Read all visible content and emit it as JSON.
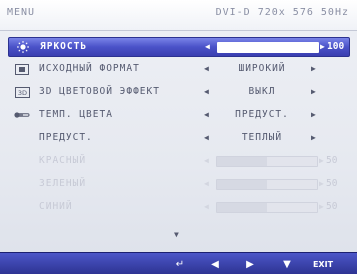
{
  "header": {
    "title": "MENU",
    "input": "DVI-D",
    "resolution": "720x 576",
    "refresh": "50Hz"
  },
  "menu": {
    "items": [
      {
        "icon": "sun-brightness-icon",
        "label": "ЯРКОСТЬ",
        "type": "slider",
        "value": 100,
        "max": 100,
        "selected": true,
        "enabled": true
      },
      {
        "icon": "aspect-ratio-icon",
        "label": "ИСХОДНЫЙ ФОРМАТ",
        "type": "option",
        "value": "ШИРОКИЙ",
        "selected": false,
        "enabled": true
      },
      {
        "icon": "3d-icon",
        "label": "3D ЦВЕТОВОЙ ЭФФЕКТ",
        "type": "option",
        "value": "ВЫКЛ",
        "selected": false,
        "enabled": true
      },
      {
        "icon": "thermometer-icon",
        "label": "ТЕМП. ЦВЕТА",
        "type": "option",
        "value": "ПРЕДУСТ.",
        "selected": false,
        "enabled": true
      },
      {
        "icon": "",
        "label": "ПРЕДУСТ.",
        "type": "option",
        "value": "ТЕПЛЫЙ",
        "selected": false,
        "enabled": true
      },
      {
        "icon": "",
        "label": "КРАСНЫЙ",
        "type": "slider",
        "value": 50,
        "max": 100,
        "selected": false,
        "enabled": false
      },
      {
        "icon": "",
        "label": "ЗЕЛЕНЫЙ",
        "type": "slider",
        "value": 50,
        "max": 100,
        "selected": false,
        "enabled": false
      },
      {
        "icon": "",
        "label": "СИНИЙ",
        "type": "slider",
        "value": 50,
        "max": 100,
        "selected": false,
        "enabled": false
      }
    ],
    "more_indicator": "down-arrow-icon"
  },
  "footer": {
    "keys": [
      {
        "name": "return-key-icon",
        "glyph": "↵"
      },
      {
        "name": "left-key-icon",
        "glyph": "◀"
      },
      {
        "name": "right-key-icon",
        "glyph": "▶"
      },
      {
        "name": "down-key-icon",
        "glyph": "▼"
      },
      {
        "name": "exit-key",
        "glyph": "EXIT"
      }
    ]
  },
  "colors": {
    "selection": "#4a52c8",
    "footer": "#3a42b0",
    "panel": "#e8eaf0",
    "text": "#555a70",
    "disabled": "#c7cad6"
  }
}
